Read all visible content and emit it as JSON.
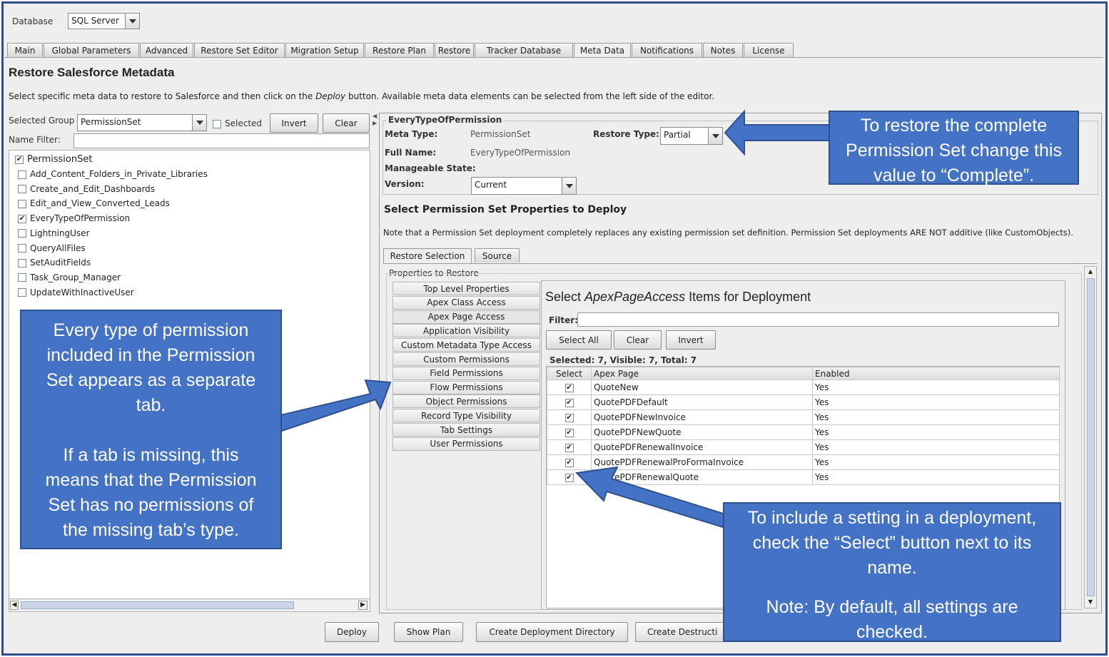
{
  "top": {
    "database_label": "Database",
    "database_value": "SQL Server"
  },
  "tabs": [
    "Main",
    "Global Parameters",
    "Advanced",
    "Restore Set Editor",
    "Migration Setup",
    "Restore Plan",
    "Restore",
    "Tracker Database",
    "Meta Data",
    "Notifications",
    "Notes",
    "License"
  ],
  "active_tab": "Meta Data",
  "page": {
    "title": "Restore Salesforce Metadata",
    "instructions_pre": "Select specific meta data to restore to Salesforce and then click on the ",
    "instructions_em": "Deploy",
    "instructions_post": " button. Available meta data elements can be selected from the left side of the editor."
  },
  "left": {
    "selected_group_label": "Selected Group",
    "selected_group_value": "PermissionSet",
    "selected_checkbox_label": "Selected",
    "invert_label": "Invert",
    "clear_label": "Clear",
    "name_filter_label": "Name Filter:",
    "root": "PermissionSet",
    "items": [
      {
        "name": "Add_Content_Folders_in_Private_Libraries",
        "checked": false
      },
      {
        "name": "Create_and_Edit_Dashboards",
        "checked": false
      },
      {
        "name": "Edit_and_View_Converted_Leads",
        "checked": false
      },
      {
        "name": "EveryTypeOfPermission",
        "checked": true
      },
      {
        "name": "LightningUser",
        "checked": false
      },
      {
        "name": "QueryAllFiles",
        "checked": false
      },
      {
        "name": "SetAuditFields",
        "checked": false
      },
      {
        "name": "Task_Group_Manager",
        "checked": false
      },
      {
        "name": "UpdateWithInactiveUser",
        "checked": false
      }
    ]
  },
  "detail": {
    "group_title": "EveryTypeOfPermission",
    "meta_type_label": "Meta Type:",
    "meta_type_value": "PermissionSet",
    "restore_type_label": "Restore Type:",
    "restore_type_value": "Partial",
    "full_name_label": "Full Name:",
    "full_name_value": "EveryTypeOfPermission",
    "manageable_state_label": "Manageable State:",
    "version_label": "Version:",
    "version_value": "Current",
    "props_heading": "Select Permission Set Properties to Deploy",
    "note": "Note that a Permission Set deployment completely replaces any existing permission set definition. Permission Set deployments ARE NOT additive (like CustomObjects).",
    "subtabs": [
      "Restore Selection",
      "Source"
    ],
    "properties_label": "Properties to Restore",
    "prop_tabs": [
      "Top Level Properties",
      "Apex Class Access",
      "Apex Page Access",
      "Application Visibility",
      "Custom Metadata Type Access",
      "Custom Permissions",
      "Field Permissions",
      "Flow Permissions",
      "Object Permissions",
      "Record Type Visibility",
      "Tab Settings",
      "User Permissions"
    ],
    "active_prop_tab": "Apex Page Access"
  },
  "items_panel": {
    "title_pre": "Select ",
    "title_em": "ApexPageAccess",
    "title_post": " Items for Deployment",
    "filter_label": "Filter:",
    "select_all_label": "Select All",
    "clear_label": "Clear",
    "invert_label": "Invert",
    "summary": "Selected: 7, Visible: 7, Total: 7",
    "columns": [
      "Select",
      "Apex Page",
      "Enabled"
    ],
    "rows": [
      {
        "page": "QuoteNew",
        "enabled": "Yes",
        "checked": true
      },
      {
        "page": "QuotePDFDefault",
        "enabled": "Yes",
        "checked": true
      },
      {
        "page": "QuotePDFNewInvoice",
        "enabled": "Yes",
        "checked": true
      },
      {
        "page": "QuotePDFNewQuote",
        "enabled": "Yes",
        "checked": true
      },
      {
        "page": "QuotePDFRenewalInvoice",
        "enabled": "Yes",
        "checked": true
      },
      {
        "page": "QuotePDFRenewalProFormaInvoice",
        "enabled": "Yes",
        "checked": true
      },
      {
        "page": "QuotePDFRenewalQuote",
        "enabled": "Yes",
        "checked": true
      }
    ]
  },
  "bottom_buttons": [
    "Deploy",
    "Show Plan",
    "Create Deployment Directory",
    "Create Destructi"
  ],
  "callouts": {
    "restore_type": [
      "To restore the complete",
      "Permission Set change this",
      "value to “Complete”."
    ],
    "tabs_info": [
      "Every type of permission",
      "included in the Permission",
      "Set appears as a separate",
      "tab.",
      "",
      "If a tab is missing, this",
      "means that the Permission",
      "Set has no permissions of",
      "the missing tab’s type."
    ],
    "select_info": [
      "To  include a setting in a deployment,",
      "check the “Select” button next to its",
      "name.",
      "",
      "Note: By default, all settings are",
      "checked."
    ]
  },
  "colors": {
    "callout_fill": "#4472c4",
    "callout_border": "#2f528f",
    "frame_border": "#2f4f8f"
  }
}
